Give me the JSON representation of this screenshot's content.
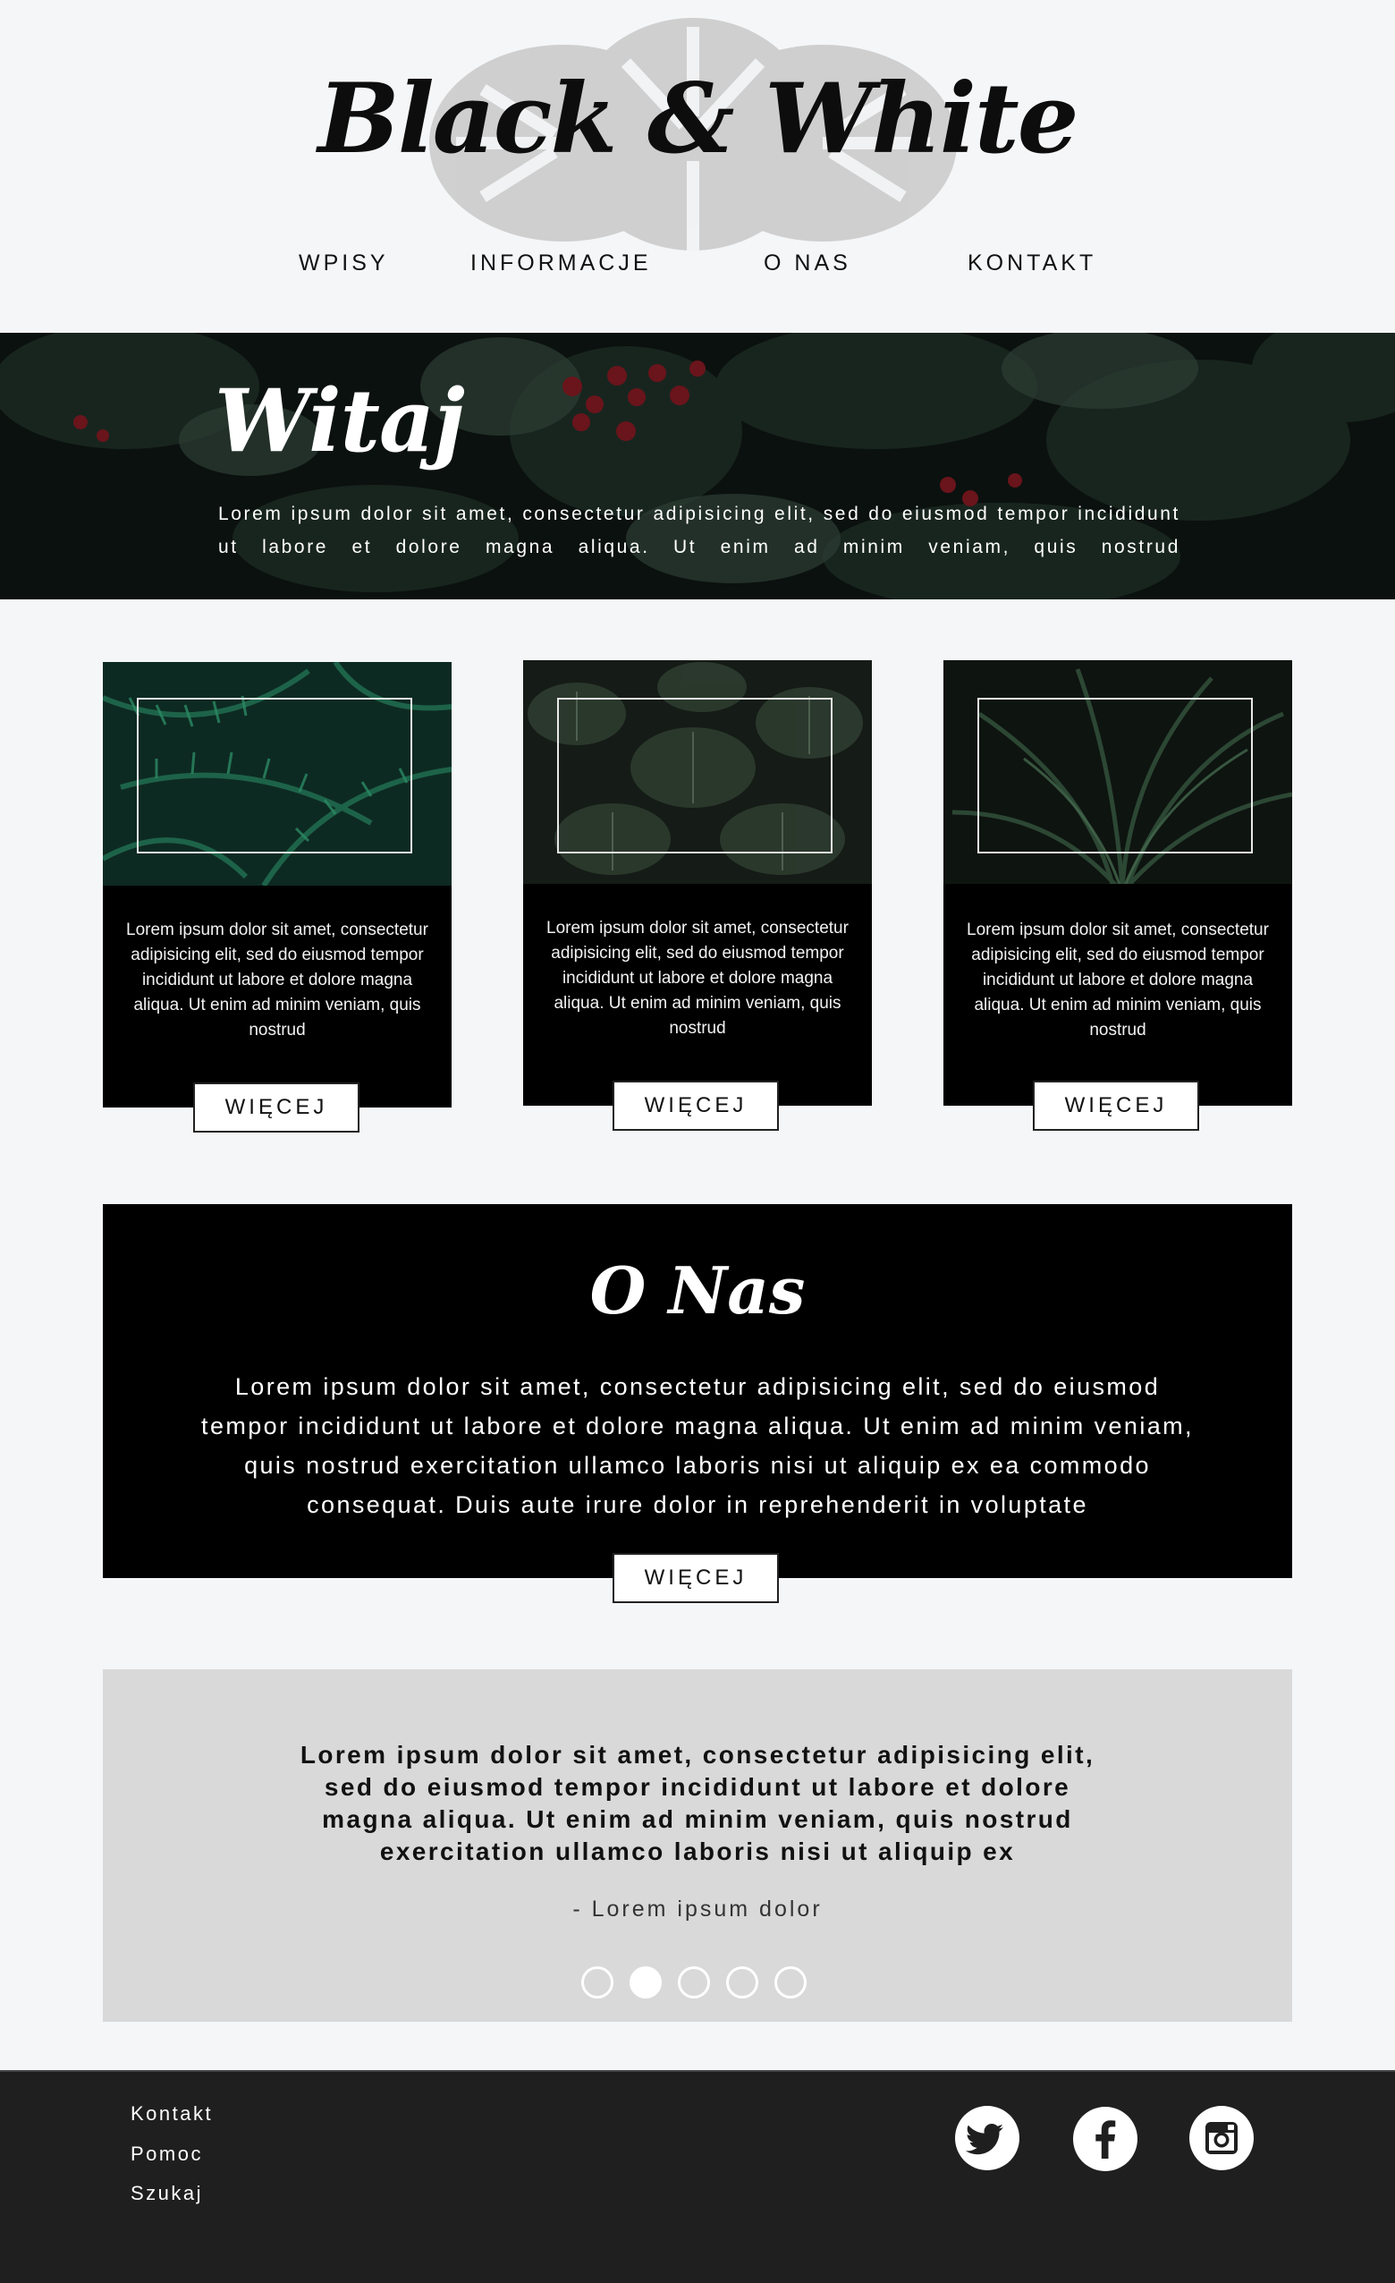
{
  "header": {
    "logo_text": "Black & White",
    "nav": [
      "WPISY",
      "INFORMACJE",
      "O NAS",
      "KONTAKT"
    ]
  },
  "hero": {
    "title": "Witaj",
    "text": "Lorem ipsum dolor sit amet, consectetur adipisicing elit, sed do eiusmod tempor incididunt ut labore et dolore magna aliqua. Ut enim ad minim veniam, quis nostrud"
  },
  "cards": [
    {
      "text": "Lorem ipsum dolor sit amet, consectetur adipisicing elit, sed do eiusmod tempor incididunt ut labore et dolore magna aliqua. Ut enim ad minim veniam, quis nostrud",
      "button": "WIĘCEJ"
    },
    {
      "text": "Lorem ipsum dolor sit amet, consectetur adipisicing elit, sed do eiusmod tempor incididunt ut labore et dolore magna aliqua. Ut enim ad minim veniam, quis nostrud",
      "button": "WIĘCEJ"
    },
    {
      "text": "Lorem ipsum dolor sit amet, consectetur adipisicing elit, sed do eiusmod tempor incididunt ut labore et dolore magna aliqua. Ut enim ad minim veniam, quis nostrud",
      "button": "WIĘCEJ"
    }
  ],
  "about": {
    "title": "O Nas",
    "text": "Lorem ipsum dolor sit amet, consectetur adipisicing elit, sed do eiusmod tempor incididunt ut labore et dolore magna aliqua. Ut enim ad minim veniam, quis nostrud exercitation ullamco laboris nisi ut aliquip ex ea commodo consequat. Duis aute irure dolor in reprehenderit in voluptate",
    "button": "WIĘCEJ"
  },
  "testimonial": {
    "quote": "Lorem ipsum dolor sit amet, consectetur adipisicing elit, sed do eiusmod tempor incididunt ut labore et dolore magna aliqua. Ut enim ad minim veniam, quis nostrud exercitation ullamco laboris nisi ut aliquip ex",
    "author": "- Lorem ipsum dolor",
    "active_dot_index": 1,
    "dot_count": 5
  },
  "footer": {
    "links": [
      "Kontakt",
      "Pomoc",
      "Szukaj"
    ],
    "social": [
      "twitter-icon",
      "facebook-icon",
      "instagram-icon"
    ]
  },
  "colors": {
    "page_bg": "#f5f6f8",
    "dark": "#000000",
    "footer_bg": "#1f1f1f",
    "testimonial_bg": "#d9d9d9"
  }
}
